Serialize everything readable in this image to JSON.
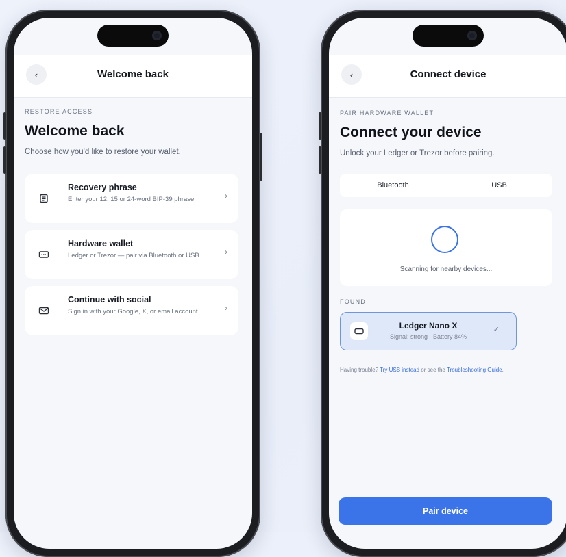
{
  "left_screen": {
    "nav": {
      "back_icon": "chevron-left-icon",
      "title": "Welcome back"
    },
    "eyebrow": "RESTORE ACCESS",
    "heading": "Welcome back",
    "subtitle": "Choose how you'd like to restore your wallet.",
    "options": [
      {
        "icon": "document-icon",
        "title": "Recovery phrase",
        "desc": "Enter your 12, 15 or 24-word BIP-39 phrase"
      },
      {
        "icon": "hardware-wallet-icon",
        "title": "Hardware wallet",
        "desc": "Ledger or Trezor — pair via Bluetooth or USB"
      },
      {
        "icon": "mail-icon",
        "title": "Continue with social",
        "desc": "Sign in with your Google, X, or email account"
      }
    ]
  },
  "right_screen": {
    "nav": {
      "back_icon": "chevron-left-icon",
      "title": "Connect device"
    },
    "eyebrow": "PAIR HARDWARE WALLET",
    "heading": "Connect your device",
    "subtitle": "Unlock your Ledger or Trezor before pairing.",
    "tabs": [
      "Bluetooth",
      "USB"
    ],
    "scanning_text": "Scanning for nearby devices...",
    "found_label": "FOUND",
    "device": {
      "name": "Ledger Nano X",
      "detail": "Signal: strong · Battery 84%"
    },
    "help": {
      "prefix": "Having trouble? ",
      "link1": "Try USB instead",
      "middle": " or see the ",
      "link2": "Troubleshooting Guide",
      "suffix": "."
    },
    "primary_button": "Pair device"
  },
  "colors": {
    "accent": "#3a74e8",
    "selected_bg": "#dfe8f8",
    "screen_bg": "#f5f7fb"
  }
}
